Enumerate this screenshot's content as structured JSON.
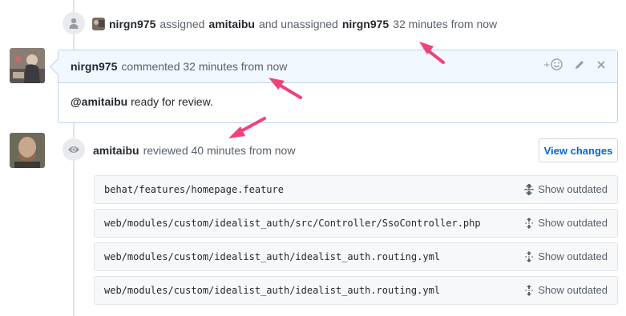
{
  "assign_event": {
    "actor": "nirgn975",
    "verb_assigned": "assigned",
    "assignee": "amitaibu",
    "verb_unassigned": "and unassigned",
    "unassignee": "nirgn975",
    "time": "32 minutes from now"
  },
  "comment": {
    "author": "nirgn975",
    "meta": "commented 32 minutes from now",
    "mention": "@amitaibu",
    "body": "ready for review.",
    "add_reaction_label": "+"
  },
  "review": {
    "author": "amitaibu",
    "meta": "reviewed 40 minutes from now",
    "view_changes_label": "View changes",
    "files": [
      {
        "path": "behat/features/homepage.feature",
        "action": "Show outdated"
      },
      {
        "path": "web/modules/custom/idealist_auth/src/Controller/SsoController.php",
        "action": "Show outdated"
      },
      {
        "path": "web/modules/custom/idealist_auth/idealist_auth.routing.yml",
        "action": "Show outdated"
      },
      {
        "path": "web/modules/custom/idealist_auth/idealist_auth.routing.yml",
        "action": "Show outdated"
      }
    ]
  },
  "colors": {
    "link": "#0366d6",
    "annotation_arrow": "#f0427a"
  },
  "icons": [
    "person-icon",
    "eye-icon",
    "smiley-icon",
    "pencil-icon",
    "close-icon",
    "unfold-icon"
  ]
}
